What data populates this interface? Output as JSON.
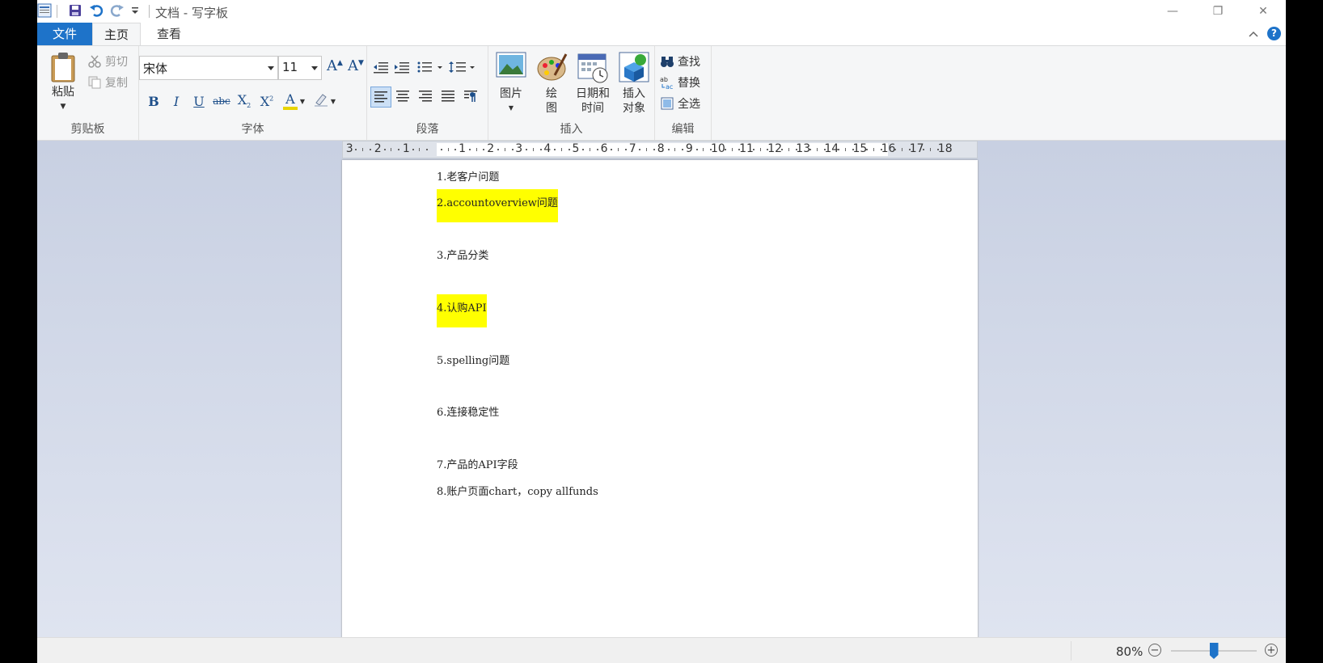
{
  "window": {
    "title": "文档 - 写字板",
    "minimize": "—",
    "restore": "❐",
    "close": "✕"
  },
  "tabs": {
    "file": "文件",
    "home": "主页",
    "view": "查看"
  },
  "clipboard": {
    "paste": "粘贴",
    "cut": "剪切",
    "copy": "复制",
    "label": "剪贴板"
  },
  "font": {
    "family": "宋体",
    "size": "11",
    "label": "字体",
    "bold": "B",
    "italic": "I",
    "underline": "U",
    "strike": "abc",
    "font_color_hex": "#e8d400",
    "highlight_hex": "#ffff00"
  },
  "paragraph": {
    "label": "段落"
  },
  "insert": {
    "picture": "图片",
    "paint_line1": "绘",
    "paint_line2": "图",
    "datetime_line1": "日期和",
    "datetime_line2": "时间",
    "object_line1": "插入",
    "object_line2": "对象",
    "label": "插入"
  },
  "editing": {
    "find": "查找",
    "replace": "替换",
    "select_all": "全选",
    "label": "编辑"
  },
  "ruler": {
    "left_numbers": [
      "3",
      "2",
      "1"
    ],
    "right_numbers": [
      "1",
      "2",
      "3",
      "4",
      "5",
      "6",
      "7",
      "8",
      "9",
      "10",
      "11",
      "12",
      "13",
      "14",
      "15",
      "16",
      "17",
      "18"
    ]
  },
  "document": {
    "lines": [
      {
        "text": "1.老客户问题",
        "highlight": false
      },
      {
        "text": "2.accountoverview问题",
        "highlight": true
      },
      {
        "text": "3.产品分类",
        "highlight": false
      },
      {
        "text": "4.认购API",
        "highlight": true
      },
      {
        "text": "5.spelling问题",
        "highlight": false
      },
      {
        "text": "6.连接稳定性",
        "highlight": false
      },
      {
        "text": "7.产品的API字段",
        "highlight": false
      },
      {
        "text": "8.账户页面chart，copy allfunds",
        "highlight": false
      }
    ]
  },
  "status": {
    "zoom": "80%",
    "zoom_minus": "−",
    "zoom_plus": "+",
    "zoom_fraction": 0.5
  },
  "colors": {
    "accent": "#1e73c9",
    "highlight": "#ffff00"
  }
}
